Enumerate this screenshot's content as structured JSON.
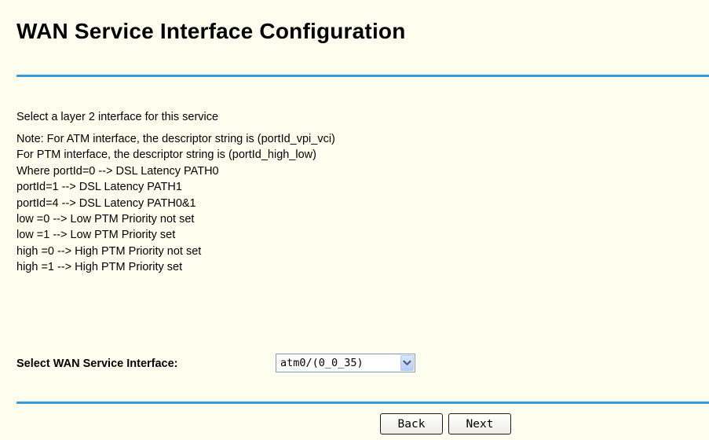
{
  "header": {
    "title": "WAN Service Interface Configuration"
  },
  "content": {
    "intro": "Select a layer 2 interface for this service",
    "notes": [
      "Note: For ATM interface, the descriptor string is (portId_vpi_vci)",
      "For PTM interface, the descriptor string is (portId_high_low)",
      "Where portId=0 --> DSL Latency PATH0",
      "portId=1 --> DSL Latency PATH1",
      "portId=4 --> DSL Latency PATH0&1",
      "low =0 --> Low PTM Priority not set",
      "low =1 --> Low PTM Priority set",
      "high =0 --> High PTM Priority not set",
      "high =1 --> High PTM Priority set"
    ]
  },
  "form": {
    "wan_interface_label": "Select WAN Service Interface:",
    "wan_interface_selected": "atm0/(0_0_35)",
    "dropdown_icon": "chevron-down-icon"
  },
  "buttons": {
    "back_label": "Back",
    "next_label": "Next"
  },
  "colors": {
    "background": "#fffff0",
    "rule": "#3a9ad9",
    "select_border": "#7f9db9"
  }
}
